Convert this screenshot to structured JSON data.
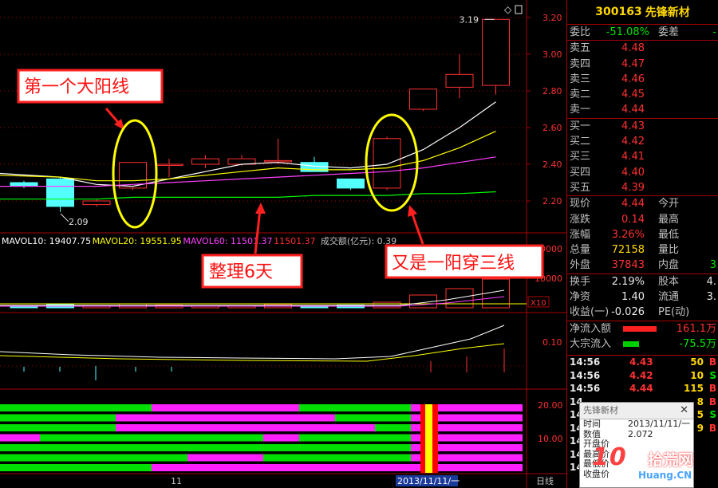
{
  "stock": {
    "code": "300163",
    "name": "先锋新材"
  },
  "quote": {
    "weibi_label": "委比",
    "weibi": "-51.08%",
    "weicha_label": "委差",
    "weicha": "-",
    "asks": [
      {
        "label": "卖五",
        "price": "4.48"
      },
      {
        "label": "卖四",
        "price": "4.47"
      },
      {
        "label": "卖三",
        "price": "4.46"
      },
      {
        "label": "卖二",
        "price": "4.45"
      },
      {
        "label": "卖一",
        "price": "4.44"
      }
    ],
    "bids": [
      {
        "label": "买一",
        "price": "4.43"
      },
      {
        "label": "买二",
        "price": "4.42"
      },
      {
        "label": "买三",
        "price": "4.41"
      },
      {
        "label": "买四",
        "price": "4.40"
      },
      {
        "label": "买五",
        "price": "4.39"
      }
    ],
    "stats": [
      {
        "l": "现价",
        "v": "4.44",
        "l2": "今开",
        "v2": ""
      },
      {
        "l": "涨跌",
        "v": "0.14",
        "l2": "最高",
        "v2": ""
      },
      {
        "l": "涨幅",
        "v": "3.26%",
        "l2": "最低",
        "v2": ""
      },
      {
        "l": "总量",
        "v": "72158",
        "l2": "量比",
        "v2": ""
      },
      {
        "l": "外盘",
        "v": "37843",
        "l2": "内盘",
        "v2": "3"
      }
    ],
    "stats2": [
      {
        "l": "换手",
        "v": "2.19%",
        "l2": "股本",
        "v2": "4."
      },
      {
        "l": "净资",
        "v": "1.40",
        "l2": "流通",
        "v2": "3."
      },
      {
        "l": "收益(一)",
        "v": "-0.026",
        "l2": "PE(动)",
        "v2": ""
      }
    ],
    "netflow_label": "净流入额",
    "netflow": "161.1万",
    "bigflow_label": "大宗流入",
    "bigflow": "-75.5万",
    "ticks": [
      {
        "t": "14:56",
        "p": "4.43",
        "q": "50",
        "s": "B"
      },
      {
        "t": "14:56",
        "p": "4.42",
        "q": "10",
        "s": "S"
      },
      {
        "t": "14:56",
        "p": "4.44",
        "q": "115",
        "s": "B"
      },
      {
        "t": "14",
        "p": "",
        "q": "8",
        "s": "B"
      },
      {
        "t": "14",
        "p": "",
        "q": "5",
        "s": "S"
      },
      {
        "t": "14",
        "p": "",
        "q": "9",
        "s": "B"
      },
      {
        "t": "14",
        "p": "",
        "q": "",
        "s": ""
      },
      {
        "t": "14",
        "p": "",
        "q": "",
        "s": ""
      },
      {
        "t": "14",
        "p": "",
        "q": "",
        "s": ""
      }
    ]
  },
  "popup": {
    "title": "先锋新材",
    "rows": [
      {
        "k": "时间",
        "v": "2013/11/11/一"
      },
      {
        "k": "数值",
        "v": "2.072"
      },
      {
        "k": "开盘价",
        "v": ""
      },
      {
        "k": "最高价",
        "v": ""
      },
      {
        "k": "最低价",
        "v": ""
      },
      {
        "k": "收盘价",
        "v": ""
      }
    ]
  },
  "watermark": {
    "a": "10",
    "b": "拾荒网",
    "c": "Huang.CN"
  },
  "chart_data": {
    "type": "candlestick",
    "ylim": [
      2.1,
      3.22
    ],
    "yticks": [
      "3.20",
      "3.00",
      "2.80",
      "2.60",
      "2.40",
      "2.20"
    ],
    "high_label": "3.19",
    "low_label": "2.09",
    "candles": [
      {
        "o": 2.3,
        "c": 2.28,
        "h": 2.31,
        "l": 2.27
      },
      {
        "o": 2.32,
        "c": 2.17,
        "h": 2.33,
        "l": 2.14
      },
      {
        "o": 2.18,
        "c": 2.2,
        "h": 2.21,
        "l": 2.17
      },
      {
        "o": 2.27,
        "c": 2.41,
        "h": 2.41,
        "l": 2.26
      },
      {
        "o": 2.4,
        "c": 2.4,
        "h": 2.43,
        "l": 2.33
      },
      {
        "o": 2.4,
        "c": 2.43,
        "h": 2.45,
        "l": 2.38
      },
      {
        "o": 2.4,
        "c": 2.43,
        "h": 2.45,
        "l": 2.39
      },
      {
        "o": 2.42,
        "c": 2.42,
        "h": 2.54,
        "l": 2.4
      },
      {
        "o": 2.41,
        "c": 2.36,
        "h": 2.44,
        "l": 2.36
      },
      {
        "o": 2.32,
        "c": 2.27,
        "h": 2.32,
        "l": 2.26
      },
      {
        "o": 2.27,
        "c": 2.54,
        "h": 2.55,
        "l": 2.26
      },
      {
        "o": 2.7,
        "c": 2.81,
        "h": 2.81,
        "l": 2.69
      },
      {
        "o": 2.82,
        "c": 2.89,
        "h": 3.0,
        "l": 2.76
      },
      {
        "o": 2.83,
        "c": 3.19,
        "h": 3.19,
        "l": 2.78
      }
    ],
    "ma": [
      {
        "color": "#ffffff",
        "values": [
          2.35,
          2.33,
          2.29,
          2.28,
          2.32,
          2.36,
          2.4,
          2.41,
          2.39,
          2.38,
          2.4,
          2.48,
          2.6,
          2.74
        ]
      },
      {
        "color": "#ffff00",
        "values": [
          2.34,
          2.33,
          2.31,
          2.31,
          2.32,
          2.34,
          2.36,
          2.38,
          2.37,
          2.37,
          2.38,
          2.42,
          2.49,
          2.58
        ]
      },
      {
        "color": "#ff40ff",
        "values": [
          2.28,
          2.28,
          2.28,
          2.29,
          2.3,
          2.31,
          2.32,
          2.33,
          2.34,
          2.35,
          2.36,
          2.38,
          2.41,
          2.44
        ]
      },
      {
        "color": "#00ff00",
        "values": [
          2.21,
          2.21,
          2.21,
          2.22,
          2.22,
          2.22,
          2.22,
          2.22,
          2.23,
          2.23,
          2.23,
          2.24,
          2.24,
          2.25
        ]
      }
    ],
    "volume_legend": [
      {
        "text": "MAVOL10: 19407.75",
        "color": "#ffffff"
      },
      {
        "text": "MAVOL20: 19551.95",
        "color": "#ffff00"
      },
      {
        "text": "MAVOL60: 11501.37",
        "color": "#ff40ff"
      },
      {
        "text": "11501.37",
        "color": "#ff3030"
      },
      {
        "text": "成交额(亿元): 0.39",
        "color": "#c0c0c0"
      }
    ],
    "volume_ticks": [
      "20000",
      "10000"
    ],
    "volume_unit": "X10",
    "indicator_tick": "0.10",
    "bottom_ticks": [
      "20.00",
      "10.00"
    ],
    "xticks": [
      "11",
      "2013/11/11/一",
      "日线"
    ],
    "annotations": [
      {
        "id": "a1",
        "text": "第一个大阳线"
      },
      {
        "id": "a2",
        "text": "整理6天"
      },
      {
        "id": "a3",
        "text": "又是一阳穿三线"
      }
    ]
  }
}
